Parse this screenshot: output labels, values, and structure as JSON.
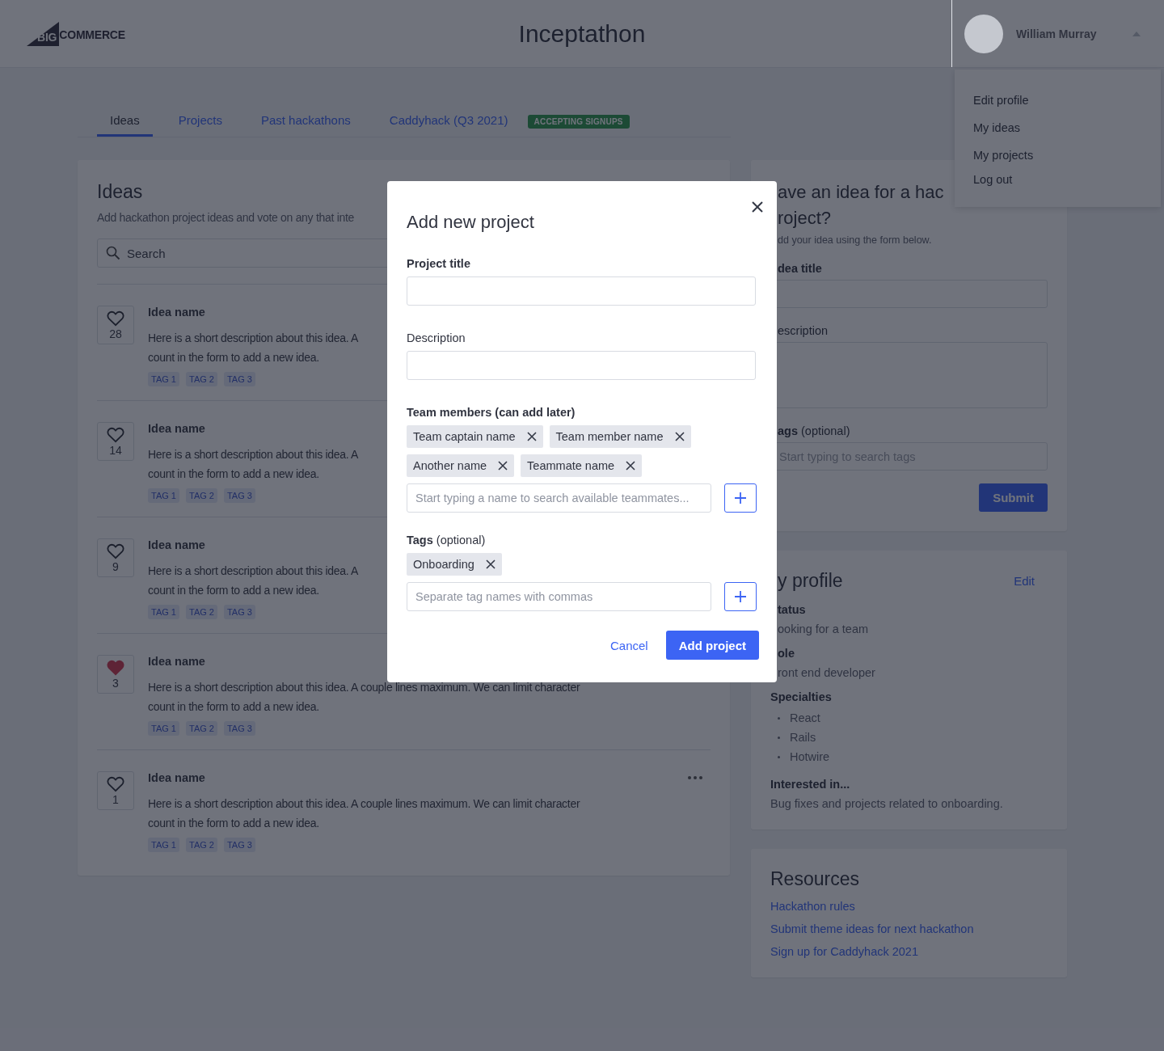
{
  "header": {
    "logo": {
      "mark": "BIG",
      "word": "COMMERCE"
    },
    "title": "Inceptathon",
    "user": {
      "name": "William Murray",
      "menu_expanded": true
    }
  },
  "user_menu": [
    "Edit profile",
    "My ideas",
    "My projects",
    "Log out"
  ],
  "tabs": [
    {
      "label": "Ideas",
      "selected": true
    },
    {
      "label": "Projects",
      "selected": false
    },
    {
      "label": "Past hackathons",
      "selected": false
    },
    {
      "label": "Caddyhack (Q3 2021)",
      "selected": false,
      "badge": "ACCEPTING SIGNUPS"
    }
  ],
  "ideas_panel": {
    "title": "Ideas",
    "subtitle": "Add hackathon project ideas and vote on any that inte",
    "search": {
      "placeholder": "Search"
    },
    "ideas": [
      {
        "name": "Idea name",
        "liked": false,
        "votes": "28",
        "description_lines": [
          "Here is a short description about this idea. A",
          "count in the form to add a new idea."
        ],
        "tags": [
          "TAG 1",
          "TAG 2",
          "TAG 3"
        ]
      },
      {
        "name": "Idea name",
        "liked": false,
        "votes": "14",
        "description_lines": [
          "Here is a short description about this idea. A",
          "count in the form to add a new idea."
        ],
        "tags": [
          "TAG 1",
          "TAG 2",
          "TAG 3"
        ]
      },
      {
        "name": "Idea name",
        "liked": false,
        "votes": "9",
        "description_lines": [
          "Here is a short description about this idea. A",
          "count in the form to add a new idea."
        ],
        "tags": [
          "TAG 1",
          "TAG 2",
          "TAG 3"
        ]
      },
      {
        "name": "Idea name",
        "liked": true,
        "votes": "3",
        "menu": false,
        "description_lines": [
          "Here is a short description about this idea. A couple lines maximum. We can limit character",
          "count in the form to add a new idea."
        ],
        "tags": [
          "TAG 1",
          "TAG 2",
          "TAG 3"
        ]
      },
      {
        "name": "Idea name",
        "liked": false,
        "votes": "1",
        "menu": true,
        "description_lines": [
          "Here is a short description about this idea. A couple lines maximum. We can limit character",
          "count in the form to add a new idea."
        ],
        "tags": [
          "TAG 1",
          "TAG 2",
          "TAG 3"
        ]
      }
    ]
  },
  "idea_form": {
    "title_lines": [
      "ave an idea for a hac",
      "roject?"
    ],
    "subtitle": "dd your idea using the form below.",
    "fields": [
      {
        "label": "dea title",
        "kind": "input"
      },
      {
        "label": "escription",
        "kind": "textarea"
      },
      {
        "label": "**ags** (optional)",
        "kind": "input",
        "placeholder": "Start typing to search tags"
      }
    ],
    "submit": "Submit"
  },
  "profile": {
    "title": "y profile",
    "edit": "Edit",
    "sections": [
      {
        "label": "tatus",
        "value": "ooking for a team"
      },
      {
        "label": "ole",
        "value": "ront end developer"
      },
      {
        "label": "Specialties",
        "list": [
          "React",
          "Rails",
          "Hotwire"
        ]
      },
      {
        "label": "Interested in...",
        "value": "Bug fixes and projects related to onboarding."
      }
    ]
  },
  "resources": {
    "title": "Resources",
    "links": [
      "Hackathon rules",
      "Submit theme ideas for next hackathon",
      "Sign up for Caddyhack 2021"
    ]
  },
  "modal": {
    "title": "Add new project",
    "project_title": {
      "label": "Project title"
    },
    "description": {
      "label": "Description"
    },
    "team": {
      "label": "**Team members** (can add later)",
      "members": [
        "Team captain name",
        "Team member name",
        "Another name",
        "Teammate name"
      ],
      "placeholder": "Start typing a name to search available teammates..."
    },
    "tags": {
      "label": "**Tags** (optional)",
      "items": [
        "Onboarding"
      ],
      "placeholder": "Separate tag names with commas"
    },
    "cancel": "Cancel",
    "confirm": "Add project"
  }
}
